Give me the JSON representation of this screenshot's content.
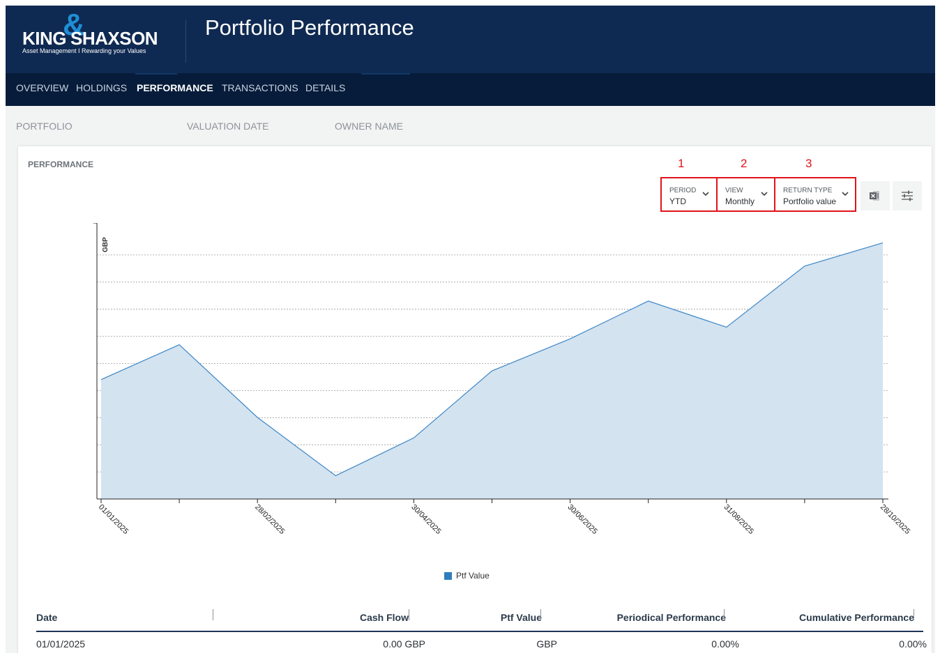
{
  "app": {
    "logo_text_a": "KING",
    "logo_text_b": "SHAXSON",
    "logo_tagline": "Asset Management I Rewarding your Values",
    "title": "Portfolio Performance"
  },
  "nav": {
    "items": [
      {
        "label": "OVERVIEW",
        "active": false
      },
      {
        "label": "HOLDINGS",
        "active": false
      },
      {
        "label": "PERFORMANCE",
        "active": true
      },
      {
        "label": "TRANSACTIONS",
        "active": false
      },
      {
        "label": "DETAILS",
        "active": false
      }
    ]
  },
  "info": {
    "portfolio_label": "PORTFOLIO",
    "valuation_date_label": "VALUATION DATE",
    "owner_name_label": "OWNER NAME"
  },
  "performance": {
    "section_title": "PERFORMANCE",
    "annotations": [
      "1",
      "2",
      "3"
    ],
    "period": {
      "label": "PERIOD",
      "value": "YTD"
    },
    "view": {
      "label": "VIEW",
      "value": "Monthly"
    },
    "return_type": {
      "label": "RETURN TYPE",
      "value": "Portfolio value"
    },
    "export_icon": "excel-export-icon",
    "settings_icon": "sliders-icon"
  },
  "chart_data": {
    "type": "area",
    "ylabel": "GBP",
    "x_tick_labels": [
      "01/01/2025",
      "28/02/2025",
      "30/04/2025",
      "30/06/2025",
      "31/08/2025",
      "28/10/2025"
    ],
    "x": [
      "01/01/2025",
      "31/01/2025",
      "28/02/2025",
      "31/03/2025",
      "30/04/2025",
      "31/05/2025",
      "30/06/2025",
      "31/07/2025",
      "31/08/2025",
      "30/09/2025",
      "28/10/2025"
    ],
    "series": [
      {
        "name": "Ptf Value",
        "values": [
          4.1,
          5.3,
          2.8,
          0.8,
          2.1,
          4.4,
          5.5,
          6.8,
          5.9,
          8.0,
          8.8
        ]
      }
    ],
    "ylim": [
      0,
      9
    ],
    "grid": true,
    "legend_position": "bottom",
    "colors": {
      "fill": "#d3e3f0",
      "line": "#3d86c6",
      "legend": "#2f7dc0"
    }
  },
  "table": {
    "headers": [
      "Date",
      "Cash Flow",
      "Ptf Value",
      "Periodical Performance",
      "Cumulative Performance"
    ],
    "rows": [
      {
        "date": "01/01/2025",
        "cash_flow": "0.00 GBP",
        "ptf_value": "GBP",
        "periodical": "0.00%",
        "cumulative": "0.00%"
      }
    ]
  }
}
